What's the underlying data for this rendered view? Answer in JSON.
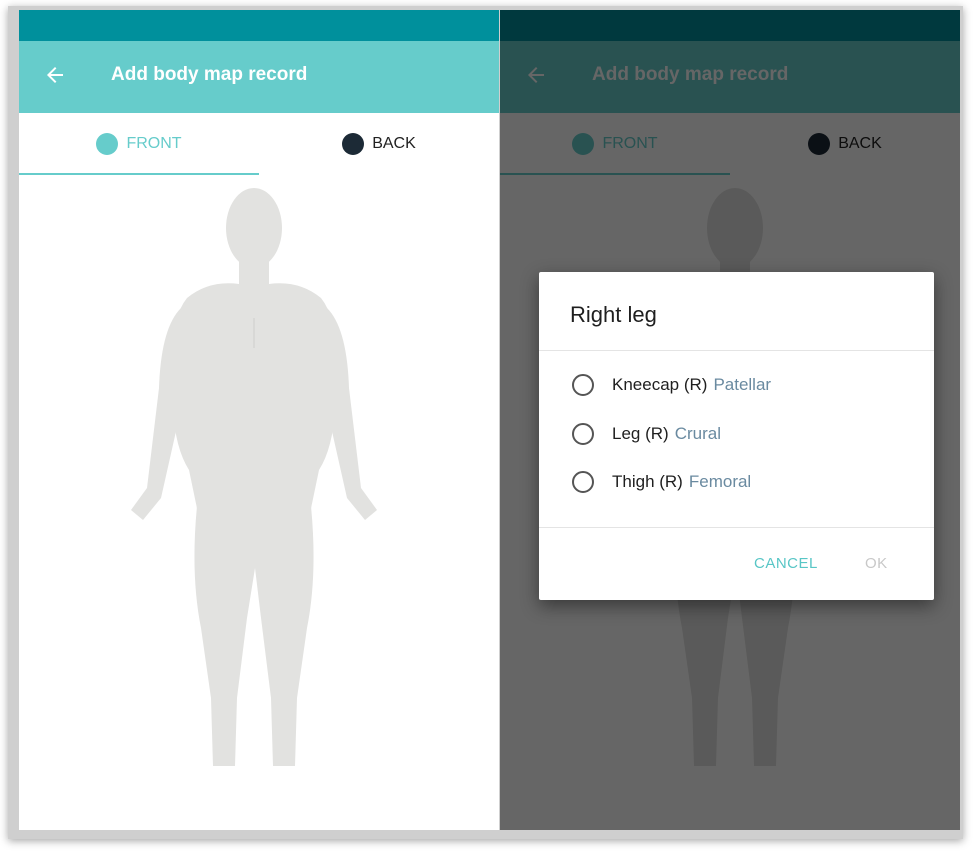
{
  "appbar": {
    "title": "Add body map record",
    "back_icon": "arrow-left-icon"
  },
  "tabs": [
    {
      "label": "FRONT",
      "selected": true
    },
    {
      "label": "BACK",
      "selected": false
    }
  ],
  "colors": {
    "status_bar": "#00909c",
    "app_bar": "#66cccb",
    "accent": "#66cccb",
    "back_dot": "#1c2a36"
  },
  "dialog": {
    "title": "Right leg",
    "options": [
      {
        "label": "Kneecap (R)",
        "latin": "Patellar",
        "checked": false
      },
      {
        "label": "Leg (R)",
        "latin": "Crural",
        "checked": false
      },
      {
        "label": "Thigh (R)",
        "latin": "Femoral",
        "checked": false
      }
    ],
    "cancel_label": "CANCEL",
    "ok_label": "OK"
  }
}
